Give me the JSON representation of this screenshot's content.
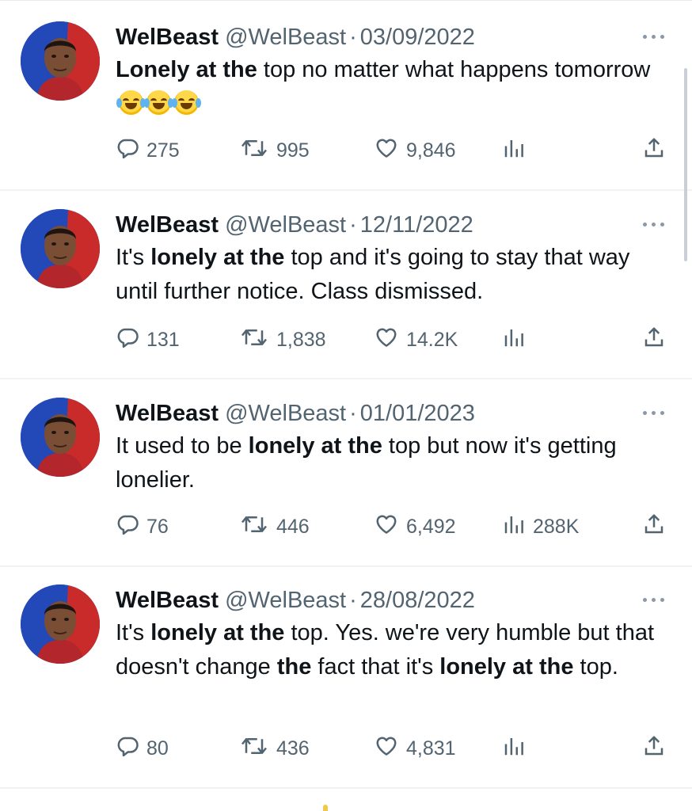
{
  "colors": {
    "text": "#0f1419",
    "secondary": "#536471",
    "divider": "#eff3f4",
    "background": "#ffffff"
  },
  "icons": {
    "reply": "reply-icon",
    "retweet": "retweet-icon",
    "like": "heart-icon",
    "views": "views-bar-chart-icon",
    "share": "share-icon",
    "more": "more-options-icon",
    "emoji": "face-with-tears-of-joy-emoji"
  },
  "tweets": [
    {
      "name": "WelBeast",
      "handle": "@WelBeast",
      "separator": "·",
      "date": "03/09/2022",
      "text": [
        {
          "t": "Lonely at the",
          "bold": true
        },
        {
          "t": " top no matter what happens tomorrow",
          "bold": false
        }
      ],
      "emoji_count": 3,
      "replies": "275",
      "retweets": "995",
      "likes": "9,846",
      "views": ""
    },
    {
      "name": "WelBeast",
      "handle": "@WelBeast",
      "separator": "·",
      "date": "12/11/2022",
      "text": [
        {
          "t": "It's ",
          "bold": false
        },
        {
          "t": "lonely at the",
          "bold": true
        },
        {
          "t": " top and it's going to stay that way until further notice. Class dismissed.",
          "bold": false
        }
      ],
      "emoji_count": 0,
      "replies": "131",
      "retweets": "1,838",
      "likes": "14.2K",
      "views": ""
    },
    {
      "name": "WelBeast",
      "handle": "@WelBeast",
      "separator": "·",
      "date": "01/01/2023",
      "text": [
        {
          "t": "It used to be ",
          "bold": false
        },
        {
          "t": "lonely at the",
          "bold": true
        },
        {
          "t": " top but now it's getting lonelier.",
          "bold": false
        }
      ],
      "emoji_count": 0,
      "replies": "76",
      "retweets": "446",
      "likes": "6,492",
      "views": "288K"
    },
    {
      "name": "WelBeast",
      "handle": "@WelBeast",
      "separator": "·",
      "date": "28/08/2022",
      "text": [
        {
          "t": "It's ",
          "bold": false
        },
        {
          "t": "lonely at the",
          "bold": true
        },
        {
          "t": " top. Yes. we're very humble but that doesn't change ",
          "bold": false
        },
        {
          "t": "the",
          "bold": true
        },
        {
          "t": " fact that it's ",
          "bold": false
        },
        {
          "t": "lonely at the",
          "bold": true
        },
        {
          "t": " top.",
          "bold": false
        }
      ],
      "emoji_count": 0,
      "replies": "80",
      "retweets": "436",
      "likes": "4,831",
      "views": ""
    }
  ]
}
